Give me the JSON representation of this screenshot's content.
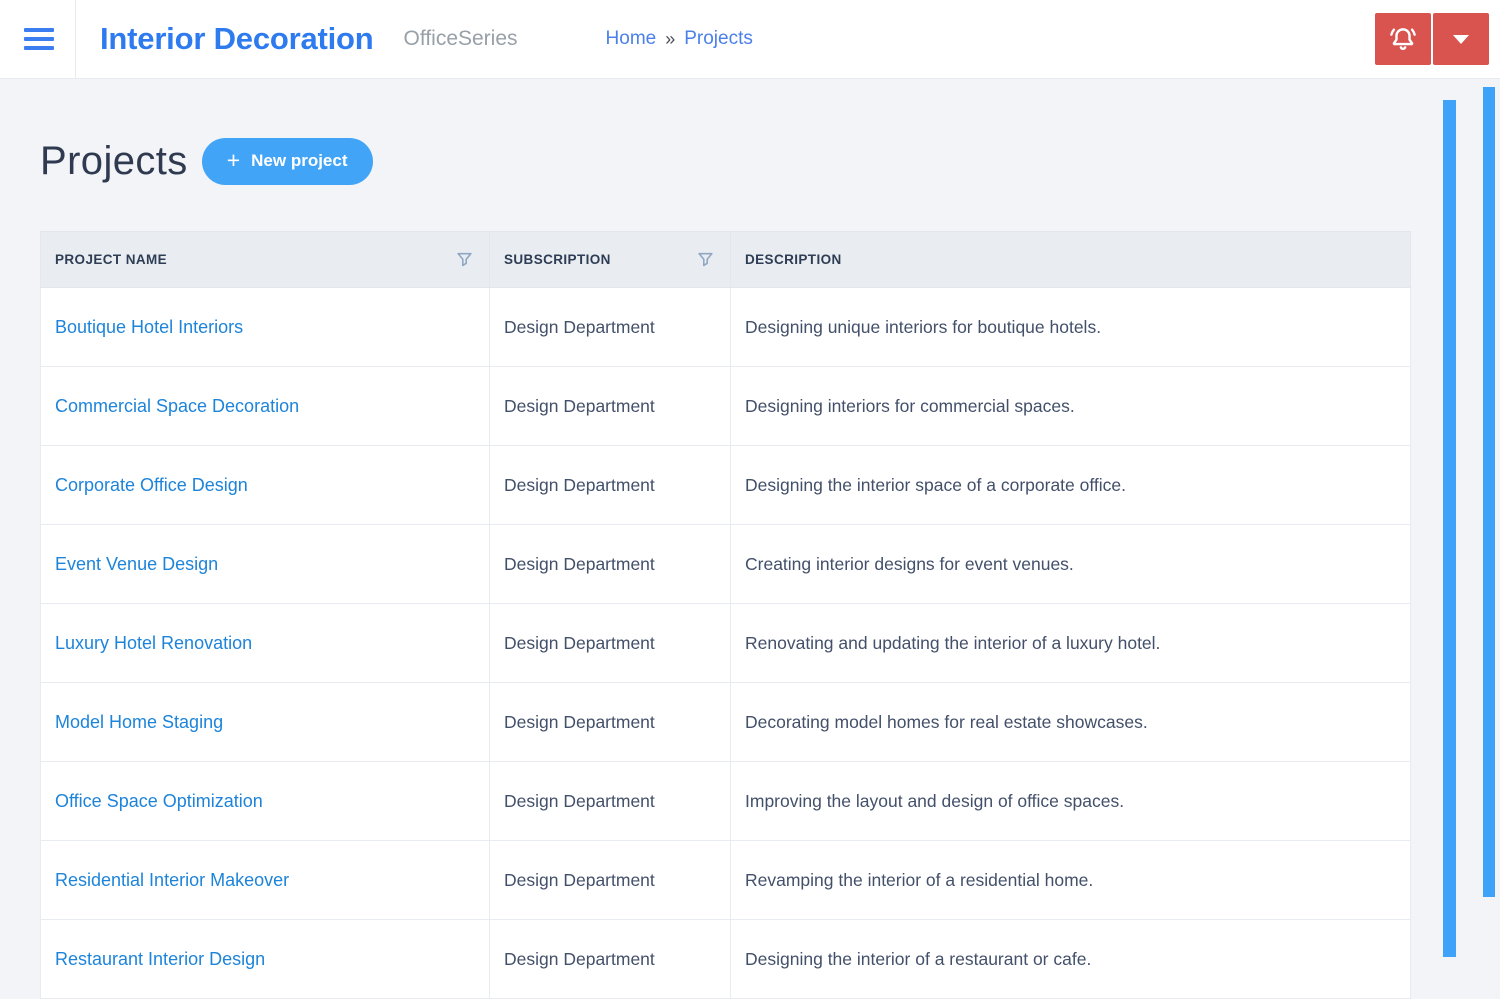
{
  "colors": {
    "brand_blue": "#2e7bf0",
    "accent_blue": "#42a4f6",
    "link_blue": "#1d84da",
    "breadcrumb_blue": "#4b80e8",
    "danger_red": "#d9534f",
    "scrollbar_blue": "#3da2f8",
    "table_header_bg": "#e9edf2",
    "page_bg": "#f2f4f7"
  },
  "header": {
    "app_title": "Interior Decoration",
    "app_subtitle": "OfficeSeries",
    "breadcrumb": {
      "home": "Home",
      "separator": "»",
      "current": "Projects"
    }
  },
  "page": {
    "title": "Projects",
    "new_project": {
      "icon": "+",
      "label": "New project"
    }
  },
  "table": {
    "columns": [
      {
        "label": "PROJECT NAME",
        "filterable": true
      },
      {
        "label": "SUBSCRIPTION",
        "filterable": true
      },
      {
        "label": "DESCRIPTION",
        "filterable": false
      }
    ],
    "rows": [
      {
        "name": "Boutique Hotel Interiors",
        "subscription": "Design Department",
        "description": "Designing unique interiors for boutique hotels."
      },
      {
        "name": "Commercial Space Decoration",
        "subscription": "Design Department",
        "description": "Designing interiors for commercial spaces."
      },
      {
        "name": "Corporate Office Design",
        "subscription": "Design Department",
        "description": "Designing the interior space of a corporate office."
      },
      {
        "name": "Event Venue Design",
        "subscription": "Design Department",
        "description": "Creating interior designs for event venues."
      },
      {
        "name": "Luxury Hotel Renovation",
        "subscription": "Design Department",
        "description": "Renovating and updating the interior of a luxury hotel."
      },
      {
        "name": "Model Home Staging",
        "subscription": "Design Department",
        "description": "Decorating model homes for real estate showcases."
      },
      {
        "name": "Office Space Optimization",
        "subscription": "Design Department",
        "description": "Improving the layout and design of office spaces."
      },
      {
        "name": "Residential Interior Makeover",
        "subscription": "Design Department",
        "description": "Revamping the interior of a residential home."
      },
      {
        "name": "Restaurant Interior Design",
        "subscription": "Design Department",
        "description": "Designing the interior of a restaurant or cafe."
      }
    ]
  },
  "icons": {
    "menu": "hamburger-icon",
    "notifications": "bell-icon",
    "account_menu": "caret-down-icon",
    "filter": "funnel-icon"
  }
}
